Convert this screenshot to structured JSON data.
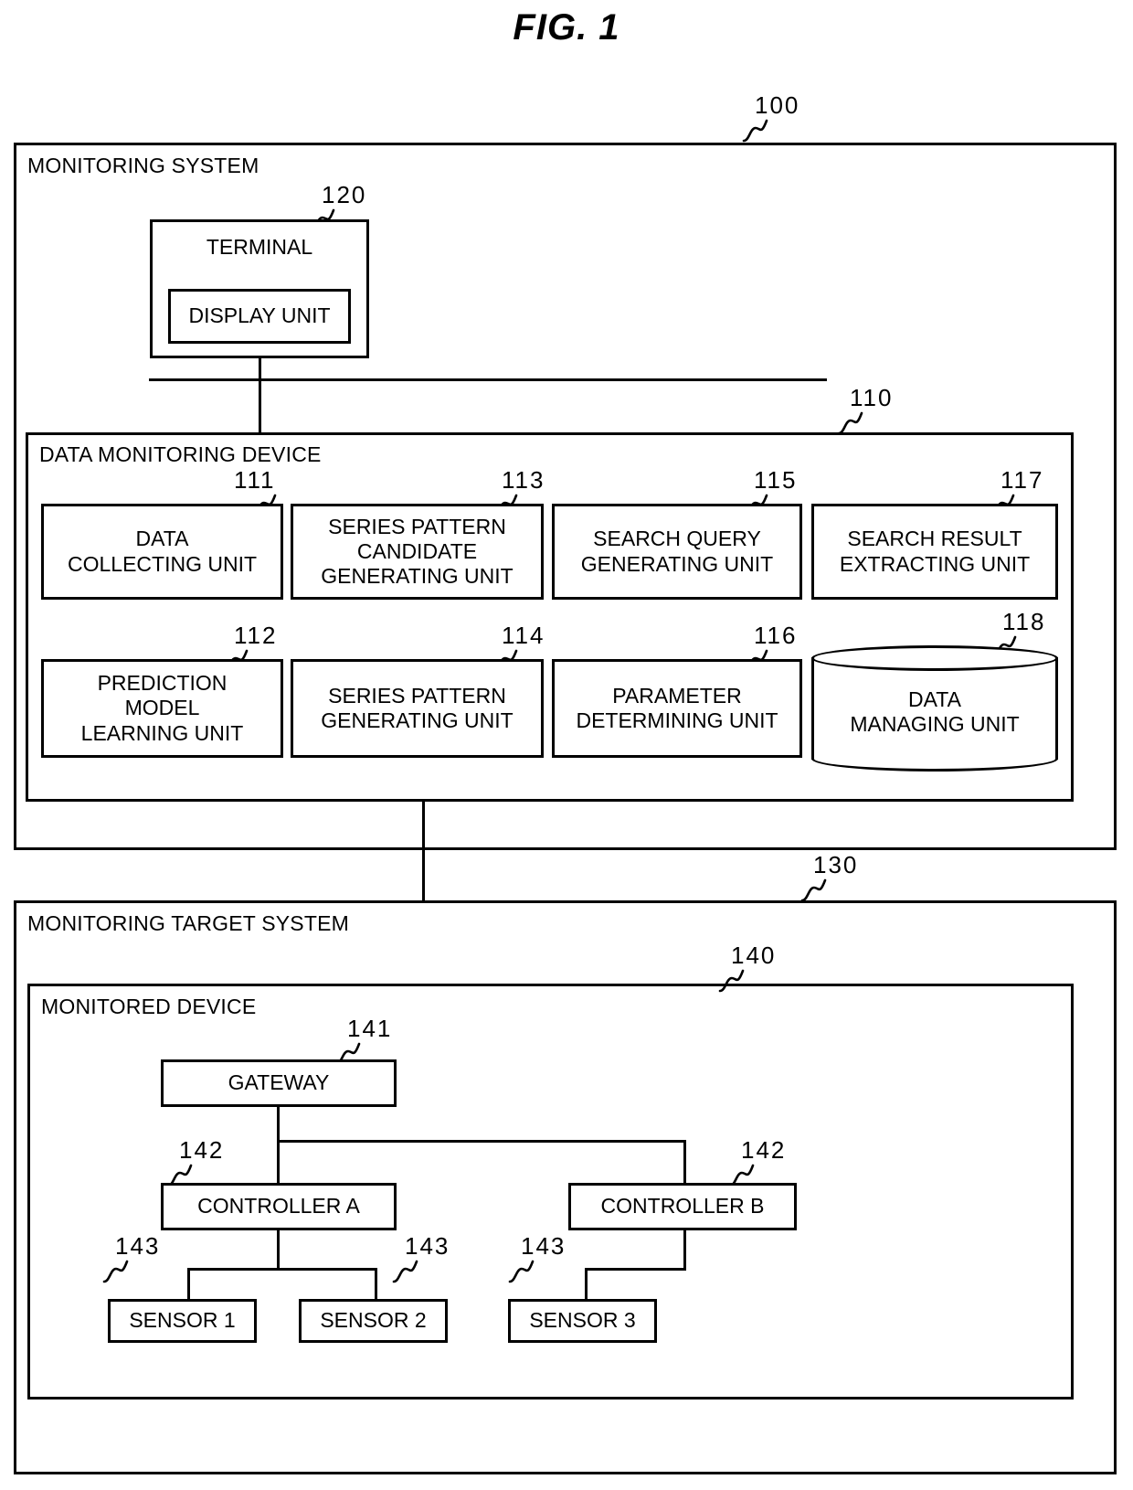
{
  "figure": {
    "title": "FIG. 1"
  },
  "monitoring_system": {
    "ref": "100",
    "label": "MONITORING SYSTEM",
    "terminal": {
      "ref": "120",
      "label": "TERMINAL",
      "display_unit": {
        "label": "DISPLAY UNIT"
      }
    },
    "data_monitoring_device": {
      "ref": "110",
      "label": "DATA MONITORING DEVICE",
      "units": [
        {
          "ref": "111",
          "lines": [
            "DATA",
            "COLLECTING UNIT"
          ],
          "shape": "box"
        },
        {
          "ref": "113",
          "lines": [
            "SERIES PATTERN",
            "CANDIDATE",
            "GENERATING UNIT"
          ],
          "shape": "box"
        },
        {
          "ref": "115",
          "lines": [
            "SEARCH QUERY",
            "GENERATING UNIT"
          ],
          "shape": "box"
        },
        {
          "ref": "117",
          "lines": [
            "SEARCH RESULT",
            "EXTRACTING UNIT"
          ],
          "shape": "box"
        },
        {
          "ref": "112",
          "lines": [
            "PREDICTION",
            "MODEL",
            "LEARNING UNIT"
          ],
          "shape": "box"
        },
        {
          "ref": "114",
          "lines": [
            "SERIES PATTERN",
            "GENERATING UNIT"
          ],
          "shape": "box"
        },
        {
          "ref": "116",
          "lines": [
            "PARAMETER",
            "DETERMINING UNIT"
          ],
          "shape": "box"
        },
        {
          "ref": "118",
          "lines": [
            "DATA",
            "MANAGING UNIT"
          ],
          "shape": "cylinder"
        }
      ]
    }
  },
  "monitoring_target_system": {
    "ref": "130",
    "label": "MONITORING TARGET SYSTEM",
    "monitored_device": {
      "ref": "140",
      "label": "MONITORED DEVICE",
      "gateway": {
        "ref": "141",
        "label": "GATEWAY"
      },
      "controllers": [
        {
          "ref": "142",
          "label": "CONTROLLER A"
        },
        {
          "ref": "142",
          "label": "CONTROLLER B"
        }
      ],
      "sensors": [
        {
          "ref": "143",
          "label": "SENSOR 1"
        },
        {
          "ref": "143",
          "label": "SENSOR 2"
        },
        {
          "ref": "143",
          "label": "SENSOR 3"
        }
      ]
    }
  }
}
